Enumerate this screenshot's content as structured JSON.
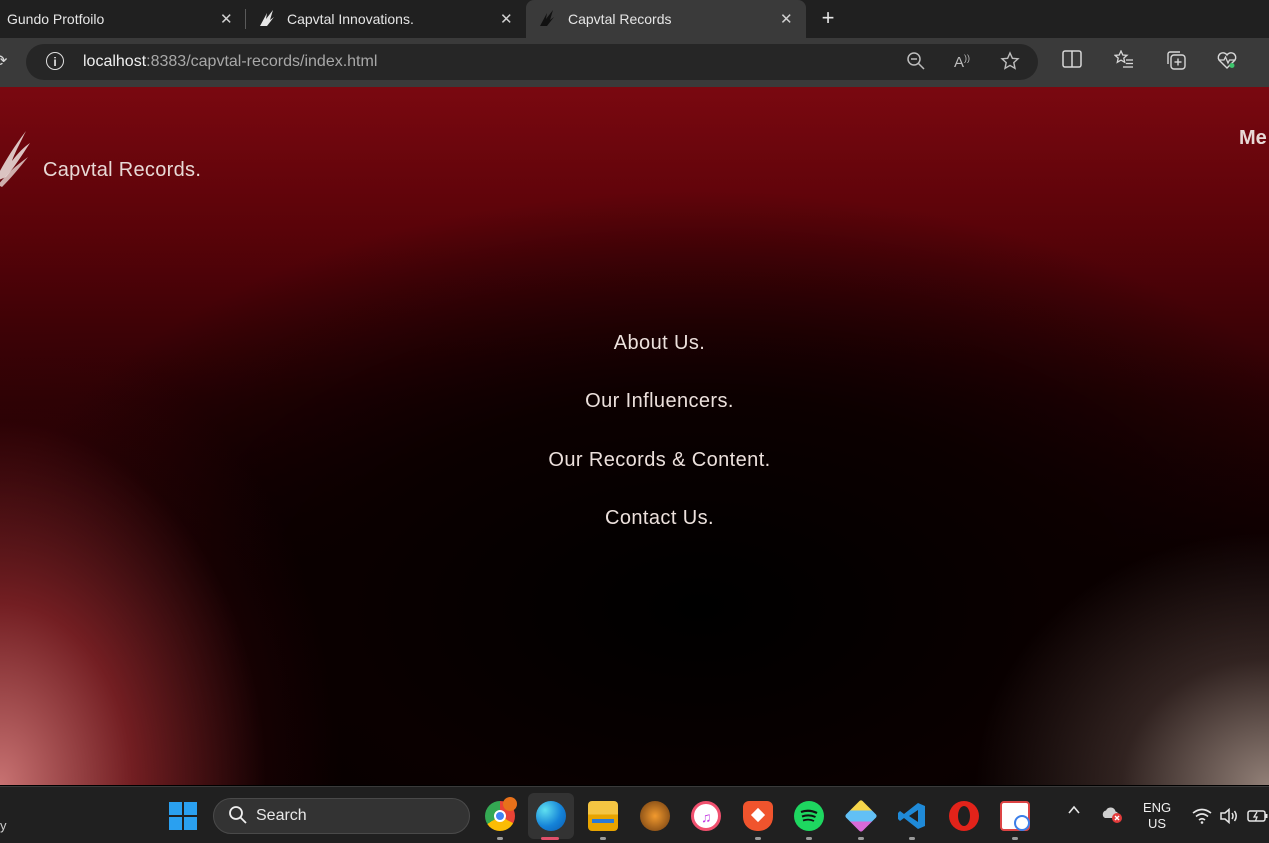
{
  "browser": {
    "tabs": [
      {
        "title": "Gundo Protfoilo",
        "active": false
      },
      {
        "title": "Capvtal Innovations.",
        "active": false
      },
      {
        "title": "Capvtal Records",
        "active": true
      }
    ],
    "close_glyph": "✕",
    "new_tab_glyph": "+",
    "url_host": "localhost",
    "url_rest": ":8383/capvtal-records/index.html",
    "info_glyph": "i"
  },
  "site": {
    "brand": "Capvtal Records.",
    "menu_label": "Me",
    "nav": [
      {
        "label": "About Us."
      },
      {
        "label": "Our Influencers."
      },
      {
        "label": "Our Records & Content."
      },
      {
        "label": "Contact Us."
      }
    ],
    "colors": {
      "top": "#7a0810",
      "mid": "#2a0104",
      "text": "#ece0dc"
    }
  },
  "taskbar": {
    "search_label": "Search",
    "lang_line1": "ENG",
    "lang_line2": "US",
    "left_edge_text": "y",
    "apps": [
      "chrome-icon",
      "edge-icon",
      "file-explorer-icon",
      "fl-studio-icon",
      "itunes-icon",
      "brave-icon",
      "spotify-icon",
      "box-app-icon",
      "vscode-icon",
      "opera-icon",
      "snipping-tool-icon"
    ]
  }
}
